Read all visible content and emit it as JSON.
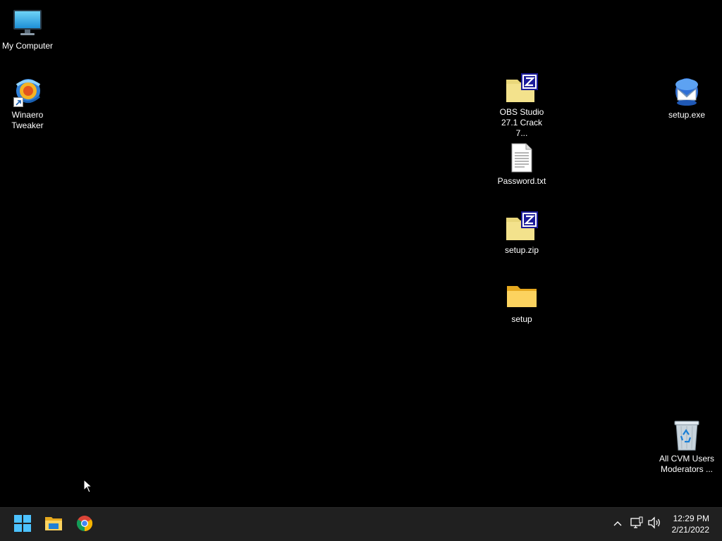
{
  "desktop": {
    "background_color": "#000000",
    "icons": [
      {
        "label": "My Computer",
        "icon": "computer-monitor-icon"
      },
      {
        "label": "Winaero\nTweaker",
        "icon": "winaero-tweaker-icon",
        "shortcut": true
      },
      {
        "label": "OBS Studio\n27.1 Crack 7...",
        "icon": "zip-archive-icon"
      },
      {
        "label": "Password.txt",
        "icon": "text-document-icon"
      },
      {
        "label": "setup.zip",
        "icon": "zip-archive-icon"
      },
      {
        "label": "setup",
        "icon": "folder-icon"
      },
      {
        "label": "setup.exe",
        "icon": "setup-installer-icon"
      },
      {
        "label": "All CVM Users\nModerators ...",
        "icon": "recycle-bin-icon"
      }
    ]
  },
  "taskbar": {
    "background_color": "#202020",
    "pinned": [
      {
        "name": "Start",
        "icon": "windows-start-icon"
      },
      {
        "name": "File Explorer",
        "icon": "file-explorer-icon"
      },
      {
        "name": "Google Chrome",
        "icon": "chrome-icon"
      }
    ],
    "tray": {
      "icons": [
        "chevron-up-icon",
        "network-icon",
        "volume-icon"
      ]
    },
    "clock": {
      "time": "12:29 PM",
      "date": "2/21/2022"
    }
  }
}
